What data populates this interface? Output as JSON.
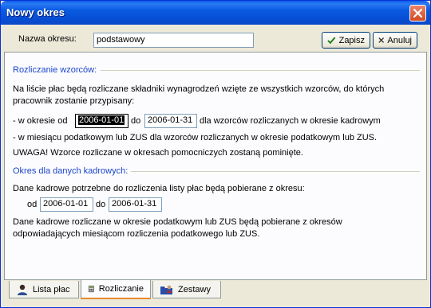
{
  "window": {
    "title": "Nowy okres"
  },
  "form": {
    "name_label": "Nazwa okresu:",
    "name_value": "podstawowy",
    "save_label": "Zapisz",
    "cancel_label": "Anuluj"
  },
  "section1": {
    "title": "Rozliczanie wzorców:",
    "desc_line1": "Na liście płac będą rozliczane składniki wynagrodzeń wzięte ze wszystkich wzorców, do których",
    "desc_line2": "pracownik zostanie przypisany:",
    "period_prefix": "- w okresie od",
    "date_from": "2006-01-01",
    "to_label": "do",
    "date_to": "2006-01-31",
    "period_suffix": "dla wzorców rozliczanych w okresie kadrowym",
    "zus_line": "- w miesiącu podatkowym lub ZUS dla wzorców rozliczanych w okresie podatkowym lub ZUS.",
    "warning": "UWAGA! Wzorce rozliczane w okresach pomocniczych zostaną pominięte."
  },
  "section2": {
    "title": "Okres dla danych kadrowych:",
    "desc": "Dane kadrowe potrzebne do rozliczenia listy płac będą pobierane z okresu:",
    "from_label": "od",
    "date_from": "2006-01-01",
    "to_label": "do",
    "date_to": "2006-01-31",
    "note_line1": "Dane kadrowe rozliczane w okresie podatkowym lub ZUS będą pobierane z okresów",
    "note_line2": "odpowiadających miesiącom rozliczenia podatkowego lub ZUS."
  },
  "tabs": [
    {
      "label": "Lista płac",
      "icon": "person-icon"
    },
    {
      "label": "Rozliczanie",
      "icon": "calculator-icon",
      "active": true
    },
    {
      "label": "Zestawy",
      "icon": "folder-people-icon"
    }
  ],
  "colors": {
    "titlebar": "#0a5ce8",
    "section_title": "#1a44cc",
    "active_tab_accent": "#e68b2c"
  }
}
